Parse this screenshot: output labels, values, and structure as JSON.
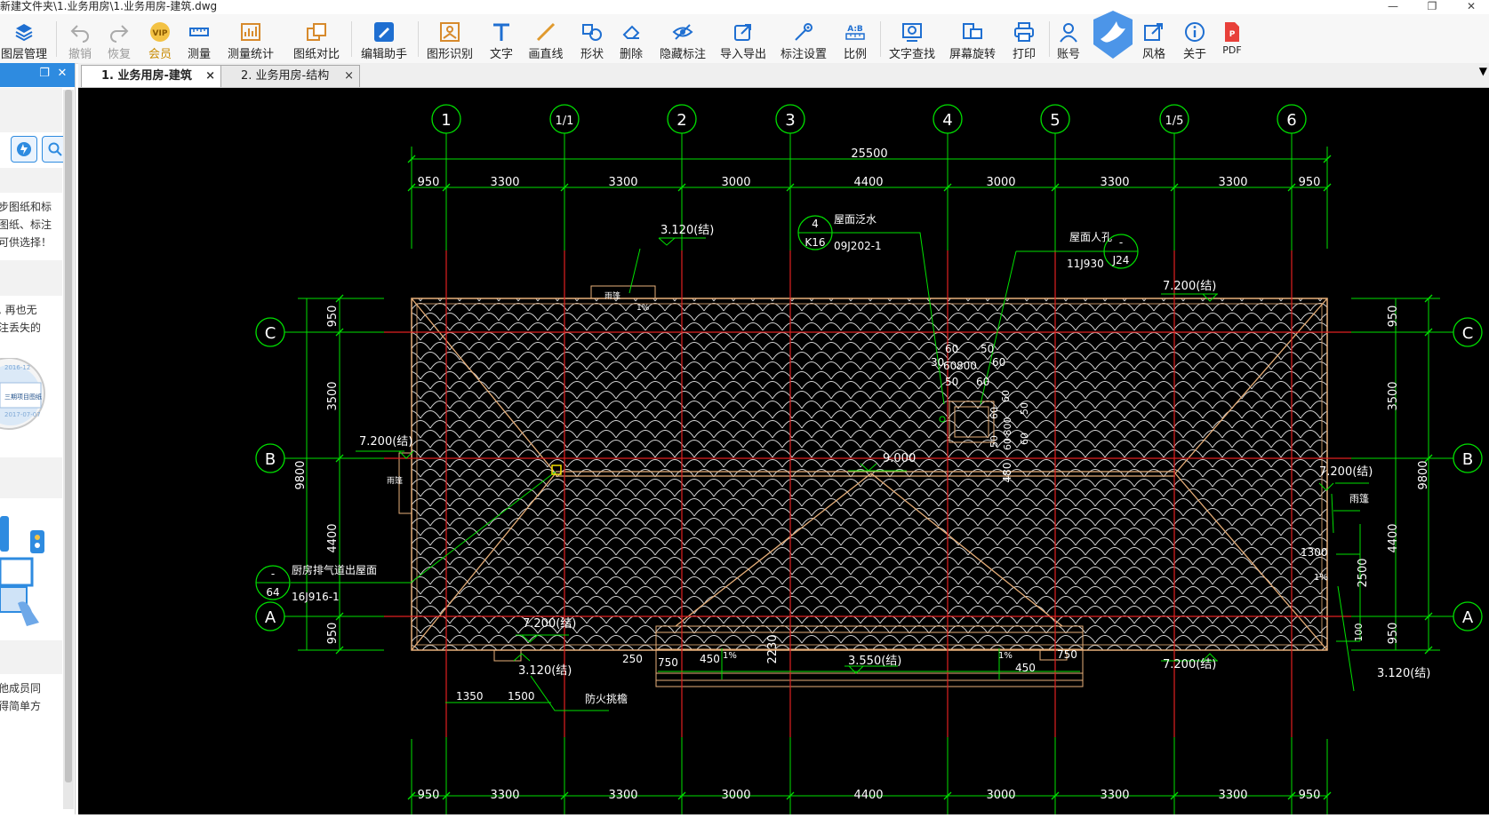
{
  "window": {
    "title": "新建文件夹\\1.业务用房\\1.业务用房-建筑.dwg",
    "minimize": "—",
    "restore": "❐",
    "close": "✕"
  },
  "toolbar": {
    "items": [
      {
        "label": "图层管理",
        "icon": "layers-icon"
      },
      {
        "label": "撤销",
        "icon": "undo-icon"
      },
      {
        "label": "恢复",
        "icon": "redo-icon"
      },
      {
        "label": "会员",
        "icon": "vip-icon",
        "badge": "VIP"
      },
      {
        "label": "测量",
        "icon": "measure-icon"
      },
      {
        "label": "测量统计",
        "icon": "measure-stats-icon"
      },
      {
        "label": "图纸对比",
        "icon": "compare-icon"
      },
      {
        "label": "编辑助手",
        "icon": "edit-assistant-icon"
      },
      {
        "label": "图形识别",
        "icon": "shape-recognition-icon"
      },
      {
        "label": "文字",
        "icon": "text-icon"
      },
      {
        "label": "画直线",
        "icon": "line-icon"
      },
      {
        "label": "形状",
        "icon": "shape-icon"
      },
      {
        "label": "删除",
        "icon": "eraser-icon"
      },
      {
        "label": "隐藏标注",
        "icon": "hide-eye-icon"
      },
      {
        "label": "导入导出",
        "icon": "import-export-icon"
      },
      {
        "label": "标注设置",
        "icon": "annotation-settings-icon"
      },
      {
        "label": "比例",
        "icon": "scale-icon",
        "badge": "A:B"
      },
      {
        "label": "文字查找",
        "icon": "text-search-icon"
      },
      {
        "label": "屏幕旋转",
        "icon": "screen-rotate-icon"
      },
      {
        "label": "打印",
        "icon": "print-icon"
      },
      {
        "label": "账号",
        "icon": "account-icon"
      },
      {
        "label": "风格",
        "icon": "style-icon"
      },
      {
        "label": "关于",
        "icon": "about-icon"
      },
      {
        "label": "PDF",
        "icon": "pdf-icon",
        "badge": "P"
      }
    ]
  },
  "tabs": [
    {
      "label": "1. 业务用房-建筑",
      "active": true
    },
    {
      "label": "2. 业务用房-结构",
      "active": false
    }
  ],
  "tabs_close": "×",
  "tabs_menu": "▼",
  "sidepanel": {
    "card1": [
      "步图纸和标",
      "图纸、标注",
      "可供选择！"
    ],
    "card2": [
      ", 再也无",
      "注丢失的"
    ],
    "card2_date1": "2016-12",
    "card2_thumb": "三期项目图纸",
    "card2_date2": "2017-07-07",
    "card4": [
      "他成员同",
      "得简单方"
    ]
  },
  "drawing": {
    "axes_top": [
      "1",
      "1/1",
      "2",
      "3",
      "4",
      "5",
      "1/5",
      "6"
    ],
    "axes_side": [
      "C",
      "B",
      "A"
    ],
    "total_dim": "25500",
    "top_dims": [
      "950",
      "3300",
      "3300",
      "3000",
      "4400",
      "3000",
      "3300",
      "3300",
      "950"
    ],
    "bottom_dims": [
      "950",
      "3300",
      "3300",
      "3000",
      "4400",
      "3000",
      "3300",
      "3300",
      "950"
    ],
    "side_dims": [
      "950",
      "3500",
      "4400",
      "950"
    ],
    "side_total": "9800",
    "labels": {
      "elev_3120": "3.120(结)",
      "elev_7200": "7.200(结)",
      "elev_9000": "9.000",
      "elev_3550": "3.550(结)",
      "roof_flashing": "屋面泛水",
      "roof_flashing_ref": "09J202-1",
      "roof_flashing_sym_top": "4",
      "roof_flashing_sym_bot": "K16",
      "roof_hatch": "屋面人孔",
      "roof_hatch_ref": "11J930",
      "roof_hatch_sym_top": "-",
      "roof_hatch_sym_bot": "J24",
      "kitchen_vent": "厨房排气道出屋面",
      "kitchen_vent_ref": "16J916-1",
      "kitchen_vent_sym_top": "-",
      "kitchen_vent_sym_bot": "64",
      "canopy": "雨篷",
      "firewall": "防火挑檐",
      "slope": "1%",
      "d_60": "60",
      "d_50": "50",
      "d_30": "30",
      "d_800": "800",
      "d_480": "480",
      "d_1300": "1300",
      "d_2500": "2500",
      "d_100": "100",
      "d_250": "250",
      "d_750": "750",
      "d_450": "450",
      "d_2230": "2230",
      "d_1350": "1350",
      "d_1500": "1500"
    }
  }
}
